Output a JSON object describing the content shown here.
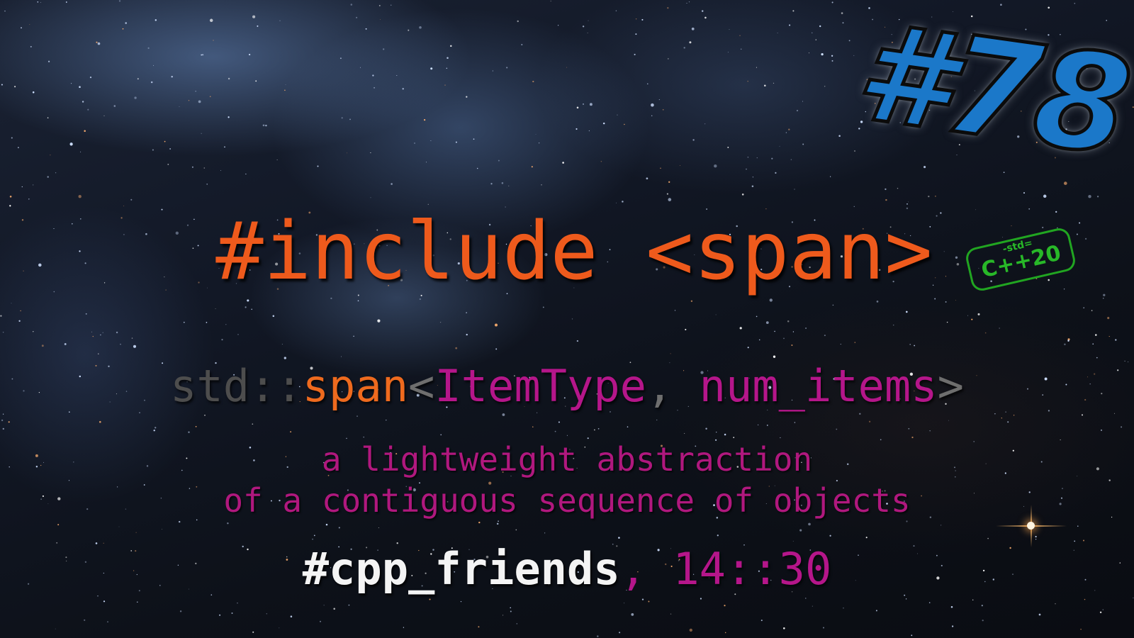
{
  "episode": {
    "number": "#78",
    "color": "#1b78c9"
  },
  "stamp": {
    "top_text": "-std=",
    "main_text": "C++20",
    "color": "#28b828"
  },
  "title": "#include <span>",
  "signature": {
    "namespace": "std::",
    "name": "span",
    "open": "<",
    "param1": "ItemType",
    "comma": ", ",
    "param2": "num_items",
    "close": ">"
  },
  "description": [
    "a lightweight abstraction",
    "of a contiguous sequence of objects"
  ],
  "footer": {
    "tag": "#cpp_friends",
    "separator": ", ",
    "time": "14::30"
  },
  "colors": {
    "title": "#ee5a1c",
    "accent": "#b5168a",
    "namespace": "#4d4d4d",
    "background": "#0d1119"
  }
}
